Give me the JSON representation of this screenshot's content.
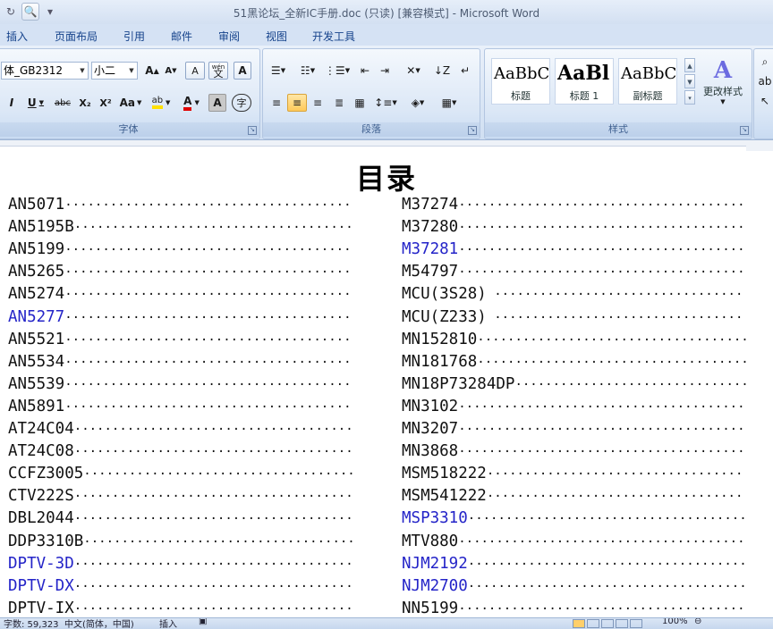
{
  "window": {
    "title": "51黑论坛_全新IC手册.doc (只读) [兼容模式] - Microsoft Word"
  },
  "ribbon_tabs": [
    "插入",
    "页面布局",
    "引用",
    "邮件",
    "审阅",
    "视图",
    "开发工具"
  ],
  "font_group": {
    "font_name": "体_GB2312",
    "font_size": "小二",
    "label": "字体",
    "grow": "A",
    "shrink": "A",
    "clear": "A",
    "wen": "wén",
    "wen_char": "文",
    "border_a": "A",
    "italic": "I",
    "underline": "U",
    "strike": "abc",
    "subscript": "X₂",
    "superscript": "X²",
    "case": "Aa",
    "highlight": "ab",
    "font_color": "A",
    "shading_a": "A",
    "enclose": "字"
  },
  "paragraph_group": {
    "label": "段落"
  },
  "styles_group": {
    "label": "样式",
    "styles": [
      {
        "sample": "AaBbC",
        "name": "标题"
      },
      {
        "sample": "AaBl",
        "name": "标题 1"
      },
      {
        "sample": "AaBbC",
        "name": "副标题"
      }
    ],
    "change_styles": "更改样式"
  },
  "document": {
    "title": "目录",
    "toc_left": [
      {
        "text": "AN5071",
        "dots": "················",
        "color": "black"
      },
      {
        "text": "AN5195B",
        "dots": "···············",
        "color": "black"
      },
      {
        "text": "AN5199",
        "dots": "················",
        "color": "black"
      },
      {
        "text": "AN5265",
        "dots": "···············",
        "color": "black"
      },
      {
        "text": "AN5274",
        "dots": "···············",
        "color": "black"
      },
      {
        "text": "AN5277",
        "dots": "···············",
        "color": "blue"
      },
      {
        "text": "AN5521",
        "dots": "···············",
        "color": "black"
      },
      {
        "text": "AN5534",
        "dots": "···············",
        "color": "black"
      },
      {
        "text": "AN5539",
        "dots": "···············",
        "color": "black"
      },
      {
        "text": "AN5891",
        "dots": "···············",
        "color": "black"
      },
      {
        "text": "AT24C04",
        "dots": "··············",
        "color": "black"
      },
      {
        "text": "AT24C08",
        "dots": "··············",
        "color": "black"
      },
      {
        "text": "CCFZ3005",
        "dots": "·············",
        "color": "black"
      },
      {
        "text": "CTV222S",
        "dots": "··············",
        "color": "black"
      },
      {
        "text": "DBL2044",
        "dots": "··············",
        "color": "black"
      },
      {
        "text": "DDP3310B",
        "dots": "·············",
        "color": "black"
      },
      {
        "text": "DPTV-3D",
        "dots": "··············",
        "color": "blue"
      },
      {
        "text": "DPTV-DX",
        "dots": "··············",
        "color": "blue"
      },
      {
        "text": "DPTV-IX",
        "dots": "··············",
        "color": "black"
      }
    ],
    "toc_right": [
      {
        "text": "M37274",
        "dots": "···············",
        "color": "black"
      },
      {
        "text": "M37280",
        "dots": "···············",
        "color": "black"
      },
      {
        "text": "M37281",
        "dots": "···············",
        "color": "blue"
      },
      {
        "text": "M54797",
        "dots": "···············",
        "color": "black"
      },
      {
        "text": "MCU(3S28)",
        "dots": " ···········",
        "color": "black"
      },
      {
        "text": "MCU(Z233)",
        "dots": " ···········",
        "color": "black"
      },
      {
        "text": "MN152810",
        "dots": "·············",
        "color": "black"
      },
      {
        "text": "MN181768",
        "dots": "·············",
        "color": "black"
      },
      {
        "text": "MN18P73284DP",
        "dots": "··········",
        "color": "black"
      },
      {
        "text": "MN3102",
        "dots": "···············",
        "color": "black"
      },
      {
        "text": "MN3207",
        "dots": "···············",
        "color": "black"
      },
      {
        "text": "MN3868",
        "dots": "···············",
        "color": "black"
      },
      {
        "text": "MSM518222",
        "dots": "············",
        "color": "black"
      },
      {
        "text": "MSM541222",
        "dots": "············",
        "color": "black"
      },
      {
        "text": "MSP3310",
        "dots": "··············",
        "color": "blue"
      },
      {
        "text": "MTV880",
        "dots": "···············",
        "color": "black"
      },
      {
        "text": "NJM2192",
        "dots": "··············",
        "color": "blue"
      },
      {
        "text": "NJM2700",
        "dots": "··············",
        "color": "blue"
      },
      {
        "text": "NN5199",
        "dots": "···············",
        "color": "black"
      }
    ]
  },
  "statusbar": {
    "words": "字数: 59,323",
    "language": "中文(简体，中国)",
    "mode": "插入",
    "zoom": "100%"
  },
  "colors": {
    "link_blue": "#2424c8",
    "ribbon_bg": "#d5e2f4",
    "active_button": "#ffc95a"
  }
}
